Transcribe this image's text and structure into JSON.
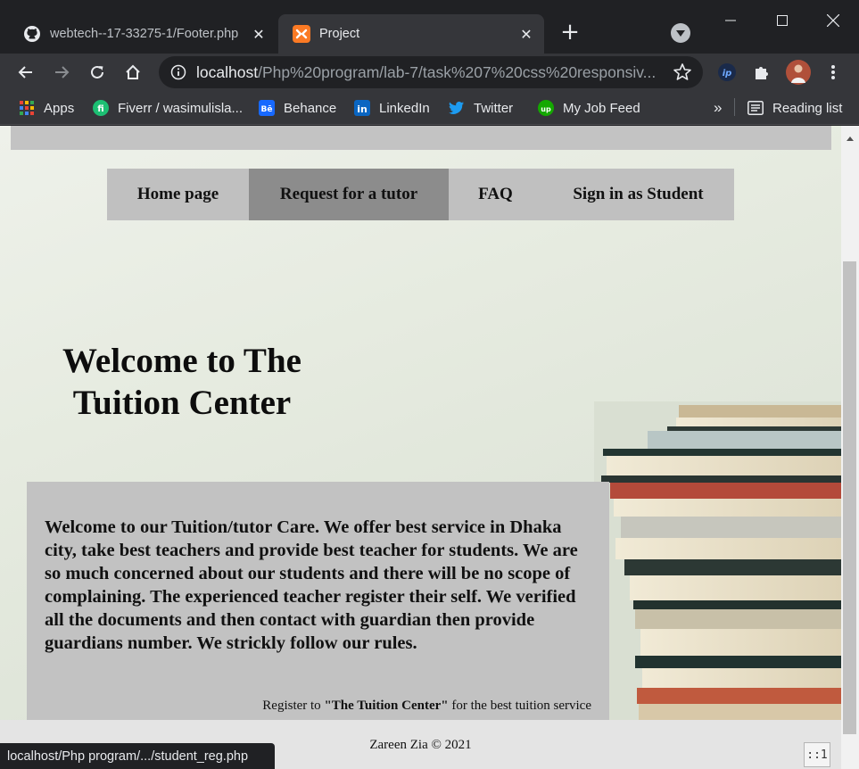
{
  "browser": {
    "tabs": [
      {
        "title": "webtech--17-33275-1/Footer.php",
        "icon": "github-icon",
        "active": false
      },
      {
        "title": "Project",
        "icon": "xampp-icon",
        "active": true
      }
    ],
    "window_controls": [
      "minimize",
      "maximize",
      "close"
    ],
    "url_host": "localhost",
    "url_path": "/Php%20program/lab-7/task%207%20css%20responsiv...",
    "bookmarks": [
      {
        "label": "Apps",
        "icon": "apps-grid-icon"
      },
      {
        "label": "Fiverr / wasimulisla...",
        "icon": "fiverr-icon"
      },
      {
        "label": "Behance",
        "icon": "behance-icon"
      },
      {
        "label": "LinkedIn",
        "icon": "linkedin-icon"
      },
      {
        "label": "Twitter",
        "icon": "twitter-icon"
      },
      {
        "label": "My Job Feed",
        "icon": "upwork-icon"
      }
    ],
    "bookmarks_overflow": "»",
    "reading_list": "Reading list"
  },
  "page": {
    "nav": [
      {
        "label": "Home page",
        "active": false
      },
      {
        "label": "Request for a tutor",
        "active": true
      },
      {
        "label": "FAQ",
        "active": false
      },
      {
        "label": "Sign in as Student",
        "active": false
      }
    ],
    "welcome_title": "Welcome to The Tuition Center",
    "intro_text": "Welcome to our Tuition/tutor Care. We offer best service in Dhaka city, take best teachers and provide best teacher for students. We are so much concerned about our students and there will be no scope of complaining. The experienced teacher register their self. We verified all the documents and then contact with guardian then provide guardians number. We strickly follow our rules.",
    "register_prefix": "Register to ",
    "register_brand": "\"The Tuition Center\"",
    "register_suffix": " for the best tuition service",
    "footer": "Zareen Zia © 2021"
  },
  "status_bar": {
    "link_url": "localhost/Php program/.../student_reg.php",
    "zoom_indicator": "::1"
  },
  "colors": {
    "chrome_dark": "#202124",
    "chrome_toolbar": "#35363a",
    "nav_bg": "#c0c0c0",
    "nav_active": "#8c8c8c",
    "content_box": "#c2c2c2"
  }
}
